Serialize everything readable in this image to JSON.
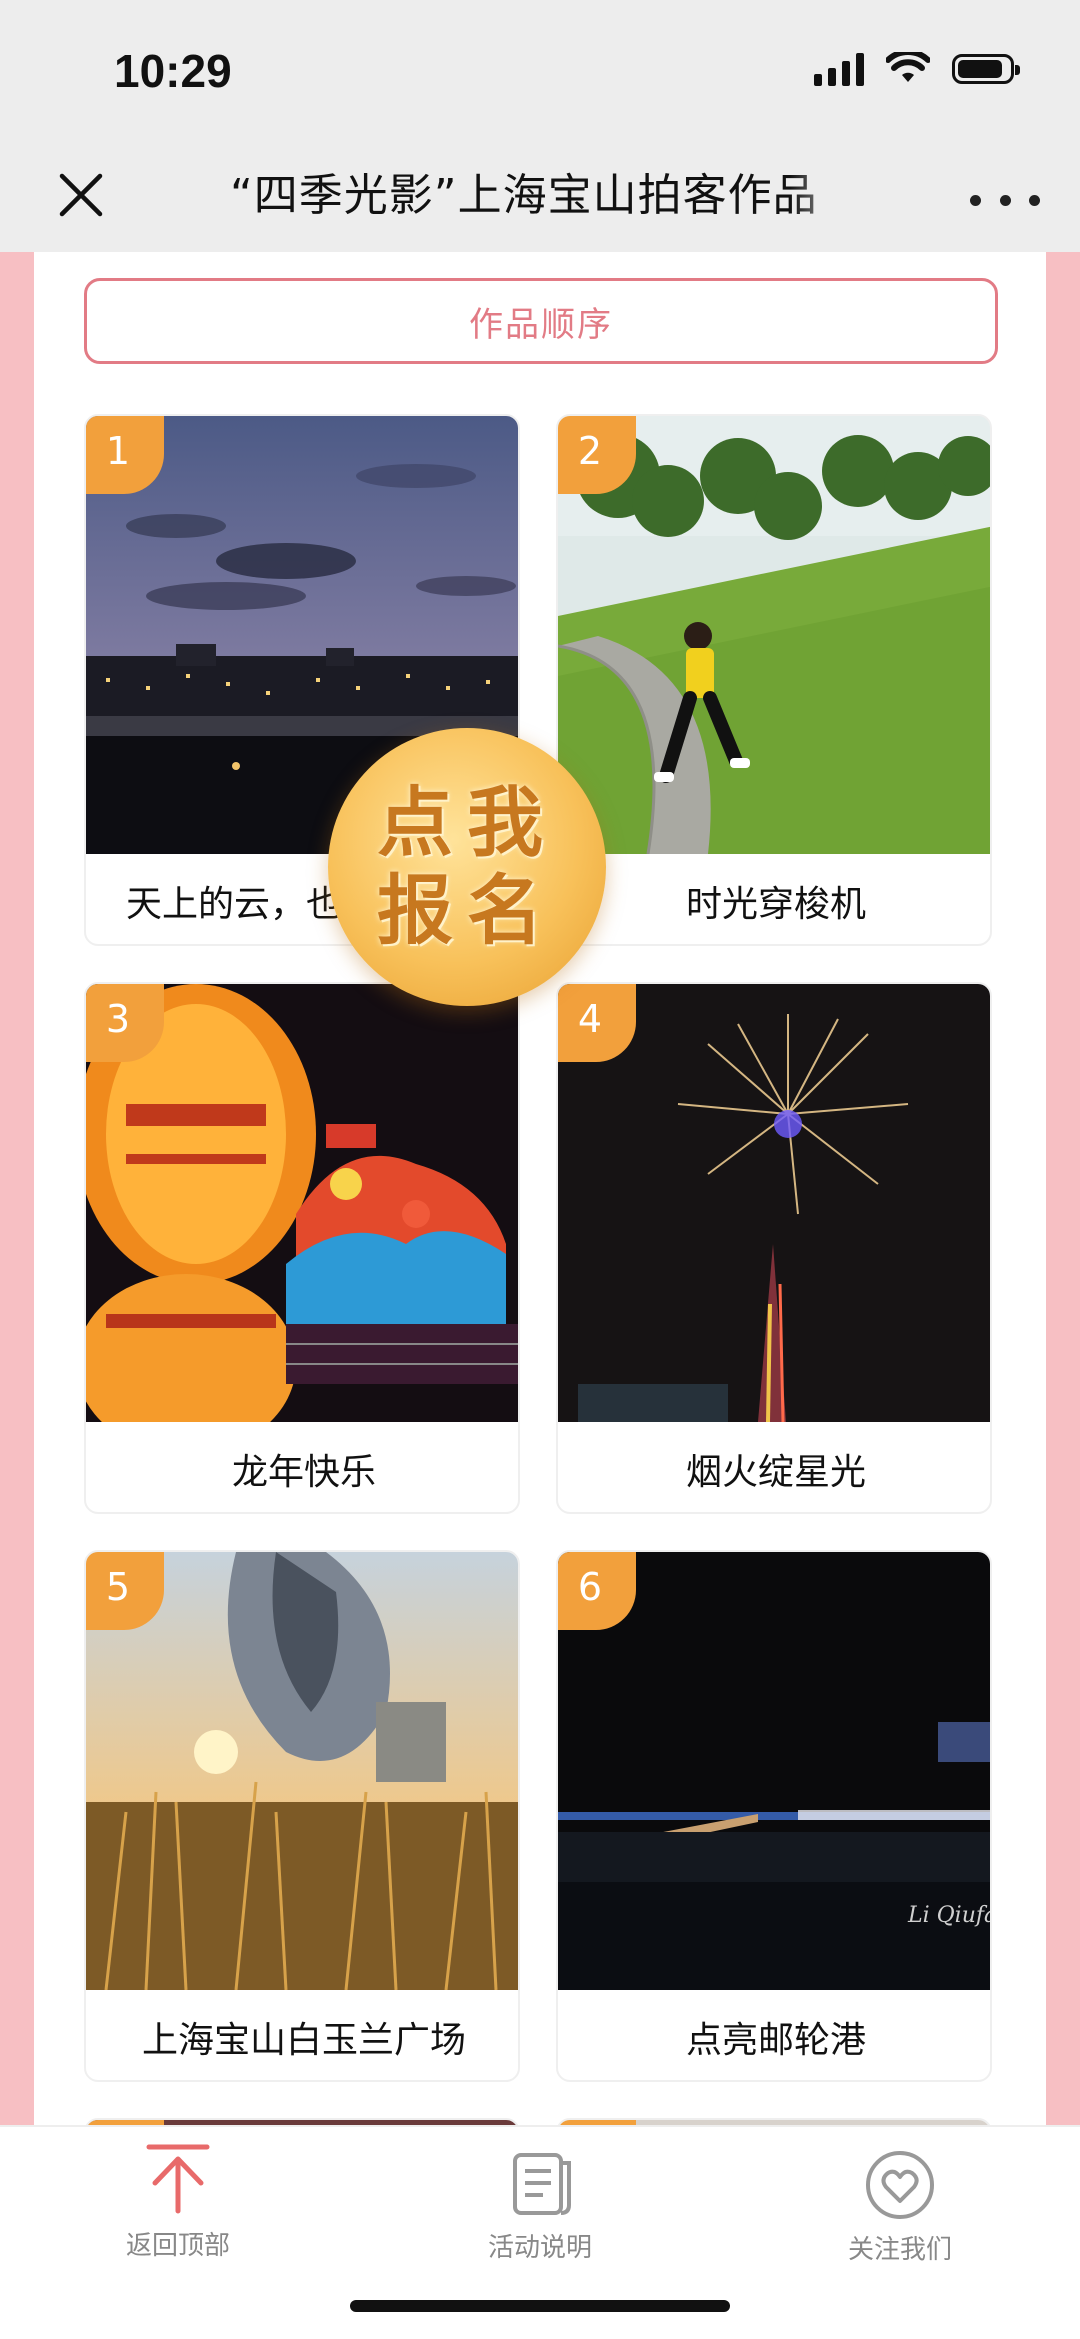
{
  "status_bar": {
    "time": "10:29"
  },
  "nav": {
    "title": "“四季光影”上海宝山拍客作品"
  },
  "order_button": {
    "label": "作品顺序"
  },
  "signup": {
    "line1": "点我",
    "line2": "报名"
  },
  "works": [
    {
      "number": "1",
      "title": "天上的云，也"
    },
    {
      "number": "2",
      "title": "时光穿梭机"
    },
    {
      "number": "3",
      "title": "龙年快乐"
    },
    {
      "number": "4",
      "title": "烟火绽星光"
    },
    {
      "number": "5",
      "title": "上海宝山白玉兰广场"
    },
    {
      "number": "6",
      "title": "点亮邮轮港"
    }
  ],
  "photo_captions": {
    "watermark": "Li Qiufan"
  },
  "tabbar": {
    "back_top": "返回顶部",
    "activity": "活动说明",
    "follow": "关注我们"
  },
  "colors": {
    "accent": "#e27b85",
    "badge": "#f2a03c",
    "side": "#f7bfc3"
  }
}
